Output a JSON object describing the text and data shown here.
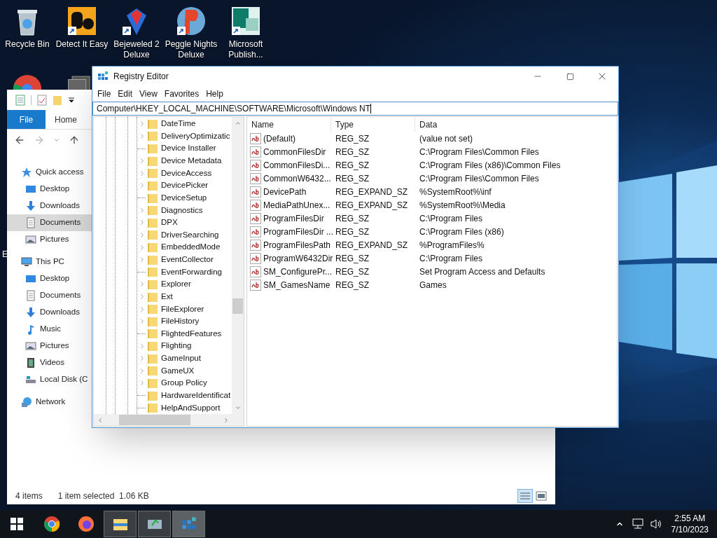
{
  "desktop": {
    "icons": [
      {
        "label": "Recycle Bin",
        "kind": "recycle",
        "shortcut": false
      },
      {
        "label": "Detect It Easy",
        "kind": "detect",
        "shortcut": true
      },
      {
        "label": "Bejeweled 2 Deluxe",
        "kind": "gem",
        "shortcut": true
      },
      {
        "label": "Peggle Nights Deluxe",
        "kind": "peggle",
        "shortcut": true
      },
      {
        "label": "Microsoft Publish...",
        "kind": "publisher",
        "shortcut": true
      }
    ],
    "edge_label": "E"
  },
  "explorer": {
    "ribbon_tabs": [
      {
        "label": "File",
        "selected": true
      },
      {
        "label": "Home",
        "selected": false
      }
    ],
    "nav_pane": [
      {
        "label": "Quick access",
        "kind": "star",
        "selected": false,
        "children": [
          {
            "label": "Desktop",
            "kind": "desktop",
            "selected": false
          },
          {
            "label": "Downloads",
            "kind": "download",
            "selected": false
          },
          {
            "label": "Documents",
            "kind": "document",
            "selected": true
          },
          {
            "label": "Pictures",
            "kind": "picture",
            "selected": false
          }
        ]
      },
      {
        "label": "This PC",
        "kind": "pc",
        "selected": false,
        "children": [
          {
            "label": "Desktop",
            "kind": "desktop",
            "selected": false
          },
          {
            "label": "Documents",
            "kind": "document",
            "selected": false
          },
          {
            "label": "Downloads",
            "kind": "download",
            "selected": false
          },
          {
            "label": "Music",
            "kind": "music",
            "selected": false
          },
          {
            "label": "Pictures",
            "kind": "picture",
            "selected": false
          },
          {
            "label": "Videos",
            "kind": "video",
            "selected": false
          },
          {
            "label": "Local Disk (C",
            "kind": "disk",
            "selected": false
          }
        ]
      },
      {
        "label": "Network",
        "kind": "network",
        "selected": false
      }
    ],
    "status_bar": {
      "item_count": "4 items",
      "selection": "1 item selected  1.06 KB"
    }
  },
  "registry_editor": {
    "title": "Registry Editor",
    "menu": [
      "File",
      "Edit",
      "View",
      "Favorites",
      "Help"
    ],
    "address": "Computer\\HKEY_LOCAL_MACHINE\\SOFTWARE\\Microsoft\\Windows NT",
    "tree": [
      {
        "label": "DateTime",
        "expandable": true
      },
      {
        "label": "DeliveryOptimizatic",
        "expandable": true
      },
      {
        "label": "Device Installer",
        "expandable": false
      },
      {
        "label": "Device Metadata",
        "expandable": true
      },
      {
        "label": "DeviceAccess",
        "expandable": true
      },
      {
        "label": "DevicePicker",
        "expandable": true
      },
      {
        "label": "DeviceSetup",
        "expandable": false
      },
      {
        "label": "Diagnostics",
        "expandable": true
      },
      {
        "label": "DPX",
        "expandable": true
      },
      {
        "label": "DriverSearching",
        "expandable": true
      },
      {
        "label": "EmbeddedMode",
        "expandable": true
      },
      {
        "label": "EventCollector",
        "expandable": true
      },
      {
        "label": "EventForwarding",
        "expandable": false
      },
      {
        "label": "Explorer",
        "expandable": true
      },
      {
        "label": "Ext",
        "expandable": true
      },
      {
        "label": "FileExplorer",
        "expandable": true
      },
      {
        "label": "FileHistory",
        "expandable": true
      },
      {
        "label": "FlightedFeatures",
        "expandable": false
      },
      {
        "label": "Flighting",
        "expandable": true
      },
      {
        "label": "GameInput",
        "expandable": true
      },
      {
        "label": "GameUX",
        "expandable": true
      },
      {
        "label": "Group Policy",
        "expandable": true
      },
      {
        "label": "HardwareIdentificat",
        "expandable": false
      },
      {
        "label": "HelpAndSupport",
        "expandable": false
      }
    ],
    "columns": [
      "Name",
      "Type",
      "Data"
    ],
    "rows": [
      {
        "name": "(Default)",
        "type": "REG_SZ",
        "data": "(value not set)"
      },
      {
        "name": "CommonFilesDir",
        "type": "REG_SZ",
        "data": "C:\\Program Files\\Common Files"
      },
      {
        "name": "CommonFilesDi...",
        "type": "REG_SZ",
        "data": "C:\\Program Files (x86)\\Common Files"
      },
      {
        "name": "CommonW6432...",
        "type": "REG_SZ",
        "data": "C:\\Program Files\\Common Files"
      },
      {
        "name": "DevicePath",
        "type": "REG_EXPAND_SZ",
        "data": "%SystemRoot%\\inf"
      },
      {
        "name": "MediaPathUnex...",
        "type": "REG_EXPAND_SZ",
        "data": "%SystemRoot%\\Media"
      },
      {
        "name": "ProgramFilesDir",
        "type": "REG_SZ",
        "data": "C:\\Program Files"
      },
      {
        "name": "ProgramFilesDir ...",
        "type": "REG_SZ",
        "data": "C:\\Program Files (x86)"
      },
      {
        "name": "ProgramFilesPath",
        "type": "REG_EXPAND_SZ",
        "data": "%ProgramFiles%"
      },
      {
        "name": "ProgramW6432Dir",
        "type": "REG_SZ",
        "data": "C:\\Program Files"
      },
      {
        "name": "SM_ConfigurePr...",
        "type": "REG_SZ",
        "data": "Set Program Access and Defaults"
      },
      {
        "name": "SM_GamesName",
        "type": "REG_SZ",
        "data": "Games"
      }
    ]
  },
  "taskbar": {
    "apps": [
      {
        "kind": "chrome",
        "running": false,
        "selected": false
      },
      {
        "kind": "firefox",
        "running": false,
        "selected": false
      },
      {
        "kind": "explorer",
        "running": true,
        "selected": false
      },
      {
        "kind": "monitor",
        "running": true,
        "selected": false
      },
      {
        "kind": "regedit",
        "running": true,
        "selected": true
      }
    ],
    "time": "2:55 AM",
    "date": "7/10/2023"
  }
}
